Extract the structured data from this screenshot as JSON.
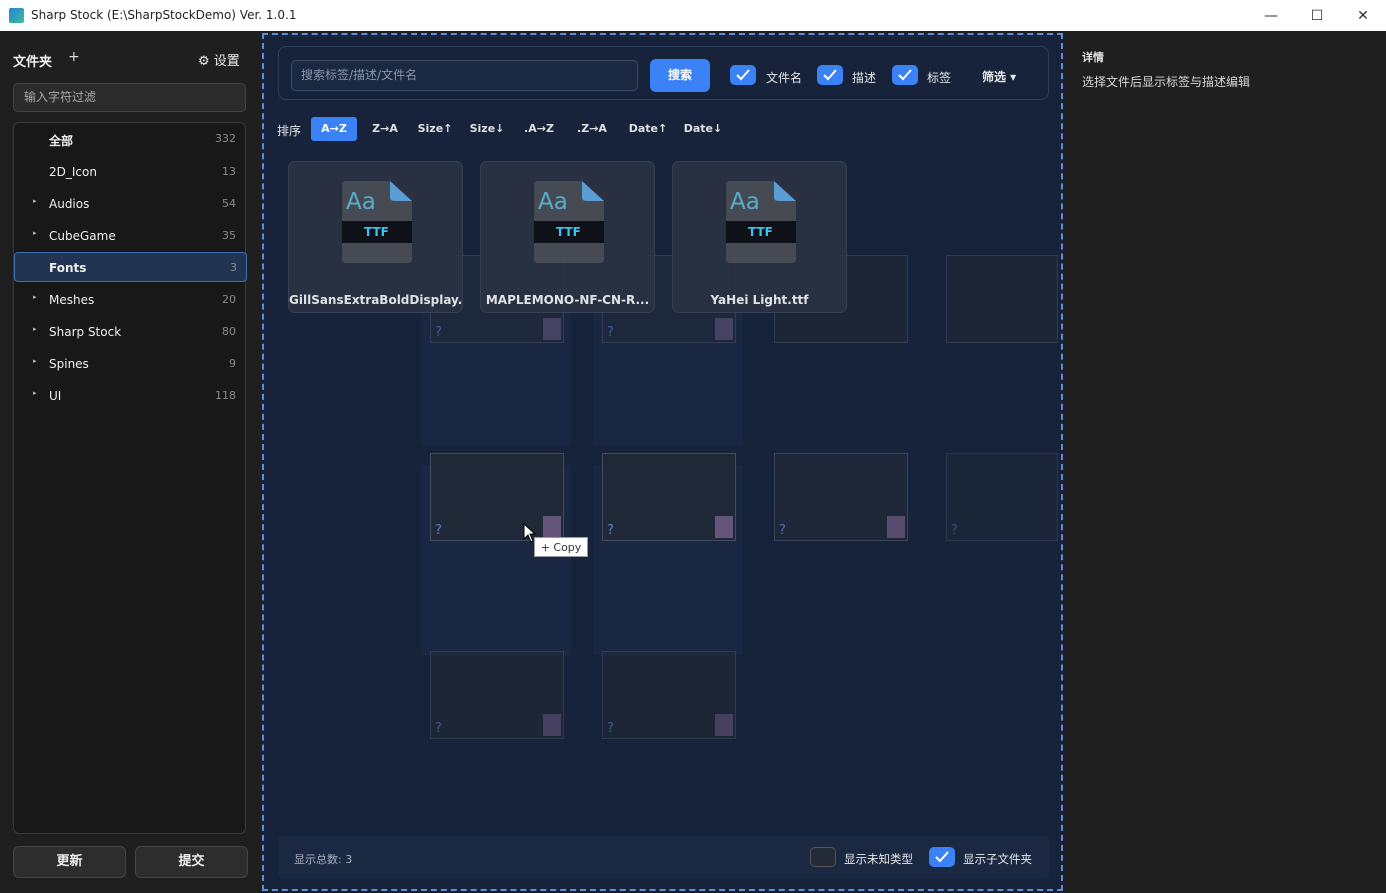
{
  "window": {
    "title": "Sharp Stock (E:\\SharpStockDemo) Ver. 1.0.1",
    "controls": {
      "minimize": "—",
      "maximize": "☐",
      "close": "✕"
    }
  },
  "sidebar": {
    "title": "文件夹",
    "add_label": "+",
    "settings_label": "⚙ 设置",
    "filter_placeholder": "输入字符过滤",
    "folders": [
      {
        "name": "全部",
        "count": "332",
        "arrow": ""
      },
      {
        "name": "2D_Icon",
        "count": "13",
        "arrow": ""
      },
      {
        "name": "Audios",
        "count": "54",
        "arrow": "▸"
      },
      {
        "name": "CubeGame",
        "count": "35",
        "arrow": "▸"
      },
      {
        "name": "Fonts",
        "count": "3",
        "arrow": ""
      },
      {
        "name": "Meshes",
        "count": "20",
        "arrow": "▸"
      },
      {
        "name": "Sharp Stock",
        "count": "80",
        "arrow": "▸"
      },
      {
        "name": "Spines",
        "count": "9",
        "arrow": "▸"
      },
      {
        "name": "UI",
        "count": "118",
        "arrow": "▸"
      }
    ],
    "selected_folder": "Fonts",
    "update_button": "更新",
    "commit_button": "提交"
  },
  "search": {
    "placeholder": "搜索标签/描述/文件名",
    "button": "搜索",
    "checkboxes": [
      {
        "label": "文件名",
        "checked": true
      },
      {
        "label": "描述",
        "checked": true
      },
      {
        "label": "标签",
        "checked": true
      }
    ],
    "filter_dropdown": "筛选 ▾"
  },
  "sort": {
    "label": "排序",
    "options": [
      "A→Z",
      "Z→A",
      "Size↑",
      "Size↓",
      ".A→Z",
      ".Z→A",
      "Date↑",
      "Date↓"
    ],
    "active": "A→Z"
  },
  "files": [
    {
      "name": "GillSansExtraBoldDisplay...",
      "icon_text": "Aa",
      "badge": "TTF"
    },
    {
      "name": "MAPLEMONO-NF-CN-R...",
      "icon_text": "Aa",
      "badge": "TTF"
    },
    {
      "name": "YaHei Light.ttf",
      "icon_text": "Aa",
      "badge": "TTF"
    }
  ],
  "drag_tooltip": "+ Copy",
  "status": {
    "total_label": "显示总数: 3",
    "show_unknown": {
      "label": "显示未知类型",
      "checked": false
    },
    "show_subfolders": {
      "label": "显示子文件夹",
      "checked": true
    }
  },
  "detail": {
    "title": "详情",
    "hint": "选择文件后显示标签与描述编辑"
  },
  "colors": {
    "accent": "#3b82f6",
    "panel_bg": "#17233a",
    "selected_bg": "#213552"
  }
}
